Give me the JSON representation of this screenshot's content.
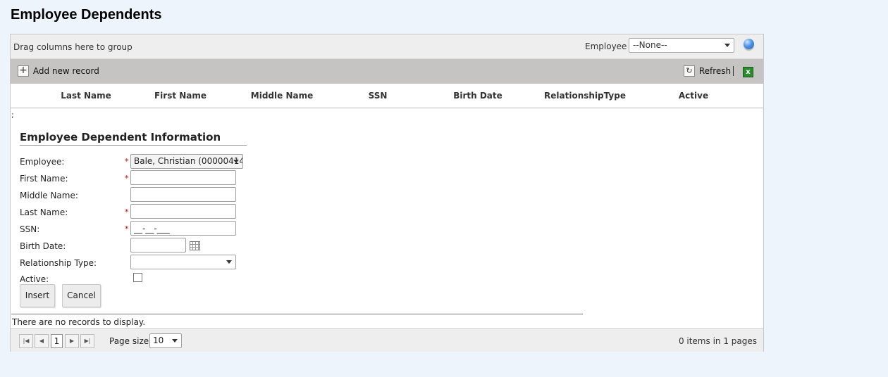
{
  "page_title": "Employee Dependents",
  "group_panel": {
    "hint": "Drag columns here to group",
    "employee_label": "Employee",
    "employee_value": "--None--"
  },
  "toolbar": {
    "add_label": "Add new record",
    "refresh_label": "Refresh",
    "separator": "|"
  },
  "columns": [
    "Last Name",
    "First Name",
    "Middle Name",
    "SSN",
    "Birth Date",
    "RelationshipType",
    "Active"
  ],
  "stray_text": ";",
  "form": {
    "title": "Employee Dependent Information",
    "employee_label": "Employee:",
    "employee_value": "Bale, Christian (00000414",
    "first_name_label": "First Name:",
    "middle_name_label": "Middle Name:",
    "last_name_label": "Last Name:",
    "ssn_label": "SSN:",
    "ssn_value": "__-__-___",
    "birth_date_label": "Birth Date:",
    "relationship_label": "Relationship Type:",
    "active_label": "Active:",
    "required_mark": "*",
    "insert_label": "Insert",
    "cancel_label": "Cancel"
  },
  "no_records": "There are no records to display.",
  "pager": {
    "current_page": "1",
    "page_size_label": "Page size:",
    "page_size_value": "10",
    "items_info": "0 items in 1 pages"
  },
  "icons": {
    "first": "first-page-icon",
    "prev": "prev-page-icon",
    "next": "next-page-icon",
    "last": "last-page-icon"
  }
}
